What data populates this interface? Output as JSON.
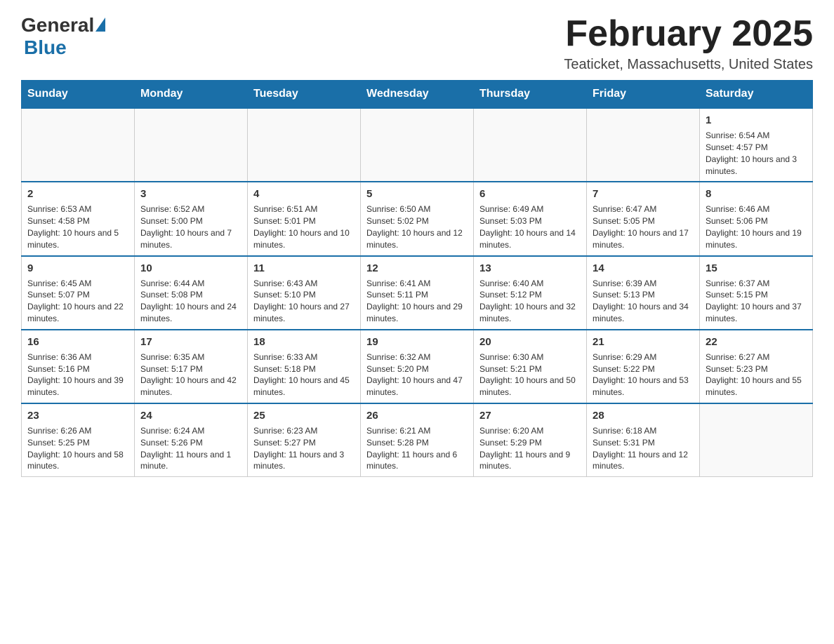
{
  "header": {
    "logo_general": "General",
    "logo_blue": "Blue",
    "month_title": "February 2025",
    "location": "Teaticket, Massachusetts, United States"
  },
  "days_of_week": [
    "Sunday",
    "Monday",
    "Tuesday",
    "Wednesday",
    "Thursday",
    "Friday",
    "Saturday"
  ],
  "weeks": [
    [
      {
        "day": "",
        "info": ""
      },
      {
        "day": "",
        "info": ""
      },
      {
        "day": "",
        "info": ""
      },
      {
        "day": "",
        "info": ""
      },
      {
        "day": "",
        "info": ""
      },
      {
        "day": "",
        "info": ""
      },
      {
        "day": "1",
        "info": "Sunrise: 6:54 AM\nSunset: 4:57 PM\nDaylight: 10 hours and 3 minutes."
      }
    ],
    [
      {
        "day": "2",
        "info": "Sunrise: 6:53 AM\nSunset: 4:58 PM\nDaylight: 10 hours and 5 minutes."
      },
      {
        "day": "3",
        "info": "Sunrise: 6:52 AM\nSunset: 5:00 PM\nDaylight: 10 hours and 7 minutes."
      },
      {
        "day": "4",
        "info": "Sunrise: 6:51 AM\nSunset: 5:01 PM\nDaylight: 10 hours and 10 minutes."
      },
      {
        "day": "5",
        "info": "Sunrise: 6:50 AM\nSunset: 5:02 PM\nDaylight: 10 hours and 12 minutes."
      },
      {
        "day": "6",
        "info": "Sunrise: 6:49 AM\nSunset: 5:03 PM\nDaylight: 10 hours and 14 minutes."
      },
      {
        "day": "7",
        "info": "Sunrise: 6:47 AM\nSunset: 5:05 PM\nDaylight: 10 hours and 17 minutes."
      },
      {
        "day": "8",
        "info": "Sunrise: 6:46 AM\nSunset: 5:06 PM\nDaylight: 10 hours and 19 minutes."
      }
    ],
    [
      {
        "day": "9",
        "info": "Sunrise: 6:45 AM\nSunset: 5:07 PM\nDaylight: 10 hours and 22 minutes."
      },
      {
        "day": "10",
        "info": "Sunrise: 6:44 AM\nSunset: 5:08 PM\nDaylight: 10 hours and 24 minutes."
      },
      {
        "day": "11",
        "info": "Sunrise: 6:43 AM\nSunset: 5:10 PM\nDaylight: 10 hours and 27 minutes."
      },
      {
        "day": "12",
        "info": "Sunrise: 6:41 AM\nSunset: 5:11 PM\nDaylight: 10 hours and 29 minutes."
      },
      {
        "day": "13",
        "info": "Sunrise: 6:40 AM\nSunset: 5:12 PM\nDaylight: 10 hours and 32 minutes."
      },
      {
        "day": "14",
        "info": "Sunrise: 6:39 AM\nSunset: 5:13 PM\nDaylight: 10 hours and 34 minutes."
      },
      {
        "day": "15",
        "info": "Sunrise: 6:37 AM\nSunset: 5:15 PM\nDaylight: 10 hours and 37 minutes."
      }
    ],
    [
      {
        "day": "16",
        "info": "Sunrise: 6:36 AM\nSunset: 5:16 PM\nDaylight: 10 hours and 39 minutes."
      },
      {
        "day": "17",
        "info": "Sunrise: 6:35 AM\nSunset: 5:17 PM\nDaylight: 10 hours and 42 minutes."
      },
      {
        "day": "18",
        "info": "Sunrise: 6:33 AM\nSunset: 5:18 PM\nDaylight: 10 hours and 45 minutes."
      },
      {
        "day": "19",
        "info": "Sunrise: 6:32 AM\nSunset: 5:20 PM\nDaylight: 10 hours and 47 minutes."
      },
      {
        "day": "20",
        "info": "Sunrise: 6:30 AM\nSunset: 5:21 PM\nDaylight: 10 hours and 50 minutes."
      },
      {
        "day": "21",
        "info": "Sunrise: 6:29 AM\nSunset: 5:22 PM\nDaylight: 10 hours and 53 minutes."
      },
      {
        "day": "22",
        "info": "Sunrise: 6:27 AM\nSunset: 5:23 PM\nDaylight: 10 hours and 55 minutes."
      }
    ],
    [
      {
        "day": "23",
        "info": "Sunrise: 6:26 AM\nSunset: 5:25 PM\nDaylight: 10 hours and 58 minutes."
      },
      {
        "day": "24",
        "info": "Sunrise: 6:24 AM\nSunset: 5:26 PM\nDaylight: 11 hours and 1 minute."
      },
      {
        "day": "25",
        "info": "Sunrise: 6:23 AM\nSunset: 5:27 PM\nDaylight: 11 hours and 3 minutes."
      },
      {
        "day": "26",
        "info": "Sunrise: 6:21 AM\nSunset: 5:28 PM\nDaylight: 11 hours and 6 minutes."
      },
      {
        "day": "27",
        "info": "Sunrise: 6:20 AM\nSunset: 5:29 PM\nDaylight: 11 hours and 9 minutes."
      },
      {
        "day": "28",
        "info": "Sunrise: 6:18 AM\nSunset: 5:31 PM\nDaylight: 11 hours and 12 minutes."
      },
      {
        "day": "",
        "info": ""
      }
    ]
  ]
}
